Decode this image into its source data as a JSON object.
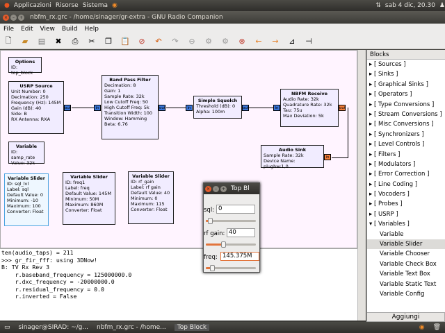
{
  "top_panel": {
    "apps": "Applicazioni",
    "places": "Risorse",
    "system": "Sistema",
    "clock": "sab  4 dic, 20.30"
  },
  "window": {
    "title": "nbfm_rx.grc - /home/sinager/gr-extra - GNU Radio Companion"
  },
  "menu": [
    "File",
    "Edit",
    "View",
    "Build",
    "Help"
  ],
  "blocks": {
    "options": {
      "title": "Options",
      "lines": [
        "ID: top_block"
      ]
    },
    "usrp": {
      "title": "USRP Source",
      "lines": [
        "Unit Number: 0",
        "Decimation: 250",
        "Frequency (Hz): 145M",
        "Gain (dB): 40",
        "Side: B",
        "RX Antenna: RXA"
      ],
      "port": "out"
    },
    "bpf": {
      "title": "Band Pass Filter",
      "lines": [
        "Decimation: 8",
        "Gain: 1",
        "Sample Rate: 32k",
        "Low Cutoff Freq: 50",
        "High Cutoff Freq: 5k",
        "Transition Width: 100",
        "Window: Hamming",
        "Beta: 6.76"
      ],
      "port_in": "in",
      "port_out": "out"
    },
    "squelch": {
      "title": "Simple Squelch",
      "lines": [
        "Threshold (dB): 0",
        "Alpha: 100m"
      ],
      "port_in": "in",
      "port_out": "out"
    },
    "nbfm": {
      "title": "NBFM Receive",
      "lines": [
        "Audio Rate: 32k",
        "Quadrature Rate: 32k",
        "Tau: 75u",
        "Max Deviation: 5k"
      ],
      "port_in": "in",
      "port_out": "out"
    },
    "audio": {
      "title": "Audio Sink",
      "lines": [
        "Sample Rate: 32k",
        "Device Name: plughw:1,0"
      ],
      "port_in": "in"
    },
    "variable": {
      "title": "Variable",
      "lines": [
        "ID: samp_rate",
        "Value: 32k"
      ]
    },
    "vs1": {
      "title": "Variable Slider",
      "lines": [
        "ID: sql_lvl",
        "Label: sql",
        "Default Value: 0",
        "Minimum: -10",
        "Maximum: 100",
        "Converter: Float"
      ]
    },
    "vs2": {
      "title": "Variable Slider",
      "lines": [
        "ID: freq1",
        "Label: freq",
        "Default Value: 145M",
        "Minimum: 50M",
        "Maximum: 860M",
        "Converter: Float"
      ]
    },
    "vs3": {
      "title": "Variable Slider",
      "lines": [
        "ID: rf_gain",
        "Label: rf gain",
        "Default Value: 40",
        "Minimum: 0",
        "Maximum: 115",
        "Converter: Float"
      ]
    }
  },
  "console": [
    "ten(audio_taps) = 211",
    ">>> gr_fir_fff: using 3DNow!",
    "B: TV Rx Rev 3",
    "    r.baseband_frequency = 125000000.0",
    "    r.dxc_frequency = -20000000.0",
    "    r.residual_frequency = 0.0",
    "    r.inverted = False"
  ],
  "blocks_panel": {
    "header": "Blocks",
    "categories": [
      "[ Sources ]",
      "[ Sinks ]",
      "[ Graphical Sinks ]",
      "[ Operators ]",
      "[ Type Conversions ]",
      "[ Stream Conversions ]",
      "[ Misc Conversions ]",
      "[ Synchronizers ]",
      "[ Level Controls ]",
      "[ Filters ]",
      "[ Modulators ]",
      "[ Error Correction ]",
      "[ Line Coding ]",
      "[ Vocoders ]",
      "[ Probes ]",
      "[ USRP ]",
      "[ Variables ]"
    ],
    "children": [
      "Variable",
      "Variable Slider",
      "Variable Chooser",
      "Variable Check Box",
      "Variable Text Box",
      "Variable Static Text",
      "Variable Config"
    ],
    "selected": "Variable Slider",
    "add_button": "Aggiungi"
  },
  "top_block": {
    "title": "Top Bl",
    "sliders": [
      {
        "label": "sql:",
        "value": "0",
        "level": 0.09
      },
      {
        "label": "rf gain:",
        "value": "40",
        "level": 0.35
      },
      {
        "label": "freq:",
        "value": "145.375M",
        "level": 0.12
      }
    ]
  },
  "taskbar": [
    "sinager@SIRAD: ~/g...",
    "nbfm_rx.grc - /home...",
    "Top Block"
  ]
}
